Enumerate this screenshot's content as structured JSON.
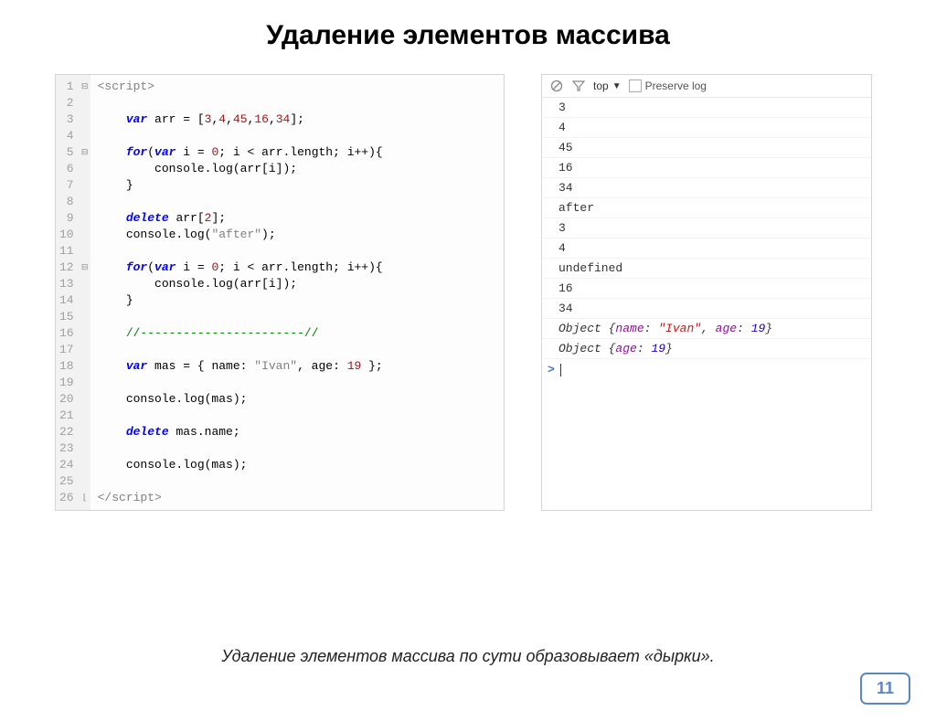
{
  "title": "Удаление элементов массива",
  "code": {
    "lines": 26,
    "fold_open": [
      1,
      5,
      12
    ],
    "fold_close": [
      26
    ],
    "content_html": [
      "<span class='tag'>&lt;script&gt;</span>",
      "",
      "    <span class='kw'>var</span> arr = [<span class='num'>3</span>,<span class='num'>4</span>,<span class='num'>45</span>,<span class='num'>16</span>,<span class='num'>34</span>];",
      "",
      "    <span class='kw'>for</span>(<span class='kw'>var</span> i = <span class='num'>0</span>; i &lt; arr.length; i++){",
      "        console.log(arr[i]);",
      "    }",
      "",
      "    <span class='kw'>delete</span> arr[<span class='num'>2</span>];",
      "    console.log(<span class='str'>\"after\"</span>);",
      "",
      "    <span class='kw'>for</span>(<span class='kw'>var</span> i = <span class='num'>0</span>; i &lt; arr.length; i++){",
      "        console.log(arr[i]);",
      "    }",
      "",
      "    <span class='cm'>//-----------------------//</span>",
      "",
      "    <span class='kw'>var</span> mas = { name: <span class='str'>\"Ivan\"</span>, age: <span class='num'>19</span> };",
      "",
      "    console.log(mas);",
      "",
      "    <span class='kw'>delete</span> mas.name;",
      "",
      "    console.log(mas);",
      "",
      "<span class='tag'>&lt;/script&gt;</span>"
    ]
  },
  "console_toolbar": {
    "context": "top",
    "preserve_label": "Preserve log"
  },
  "console": [
    {
      "text": "3"
    },
    {
      "text": "4"
    },
    {
      "text": "45"
    },
    {
      "text": "16"
    },
    {
      "text": "34"
    },
    {
      "text": "after"
    },
    {
      "text": "3"
    },
    {
      "text": "4"
    },
    {
      "text": "undefined"
    },
    {
      "text": "16"
    },
    {
      "text": "34"
    },
    {
      "type": "obj",
      "html": "Object {<span class='key'>name</span>: <span class='val-str'>\"Ivan\"</span>, <span class='key'>age</span>: <span class='val-num'>19</span>}"
    },
    {
      "type": "obj",
      "html": "Object {<span class='key'>age</span>: <span class='val-num'>19</span>}"
    }
  ],
  "footnote": "Удаление элементов массива по сути образовывает «дырки».",
  "page_number": "11"
}
